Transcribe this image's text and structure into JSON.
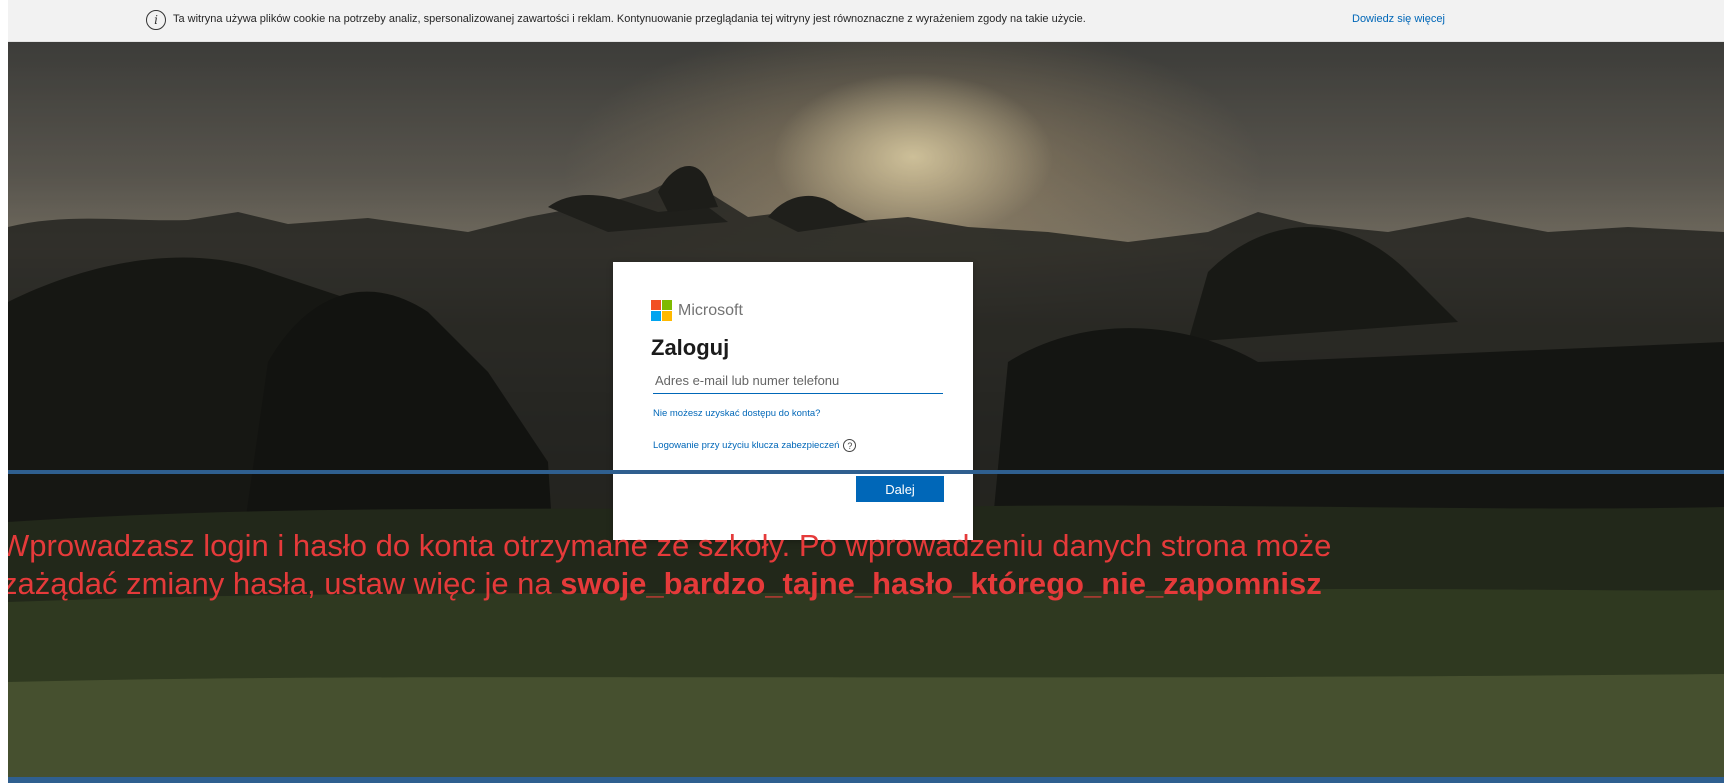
{
  "cookie_bar": {
    "text": "Ta witryna używa plików cookie na potrzeby analiz, spersonalizowanej zawartości i reklam. Kontynuowanie przeglądania tej witryny jest równoznaczne z wyrażeniem zgody na takie użycie.",
    "learn_more": "Dowiedz się więcej",
    "icon": "info-icon"
  },
  "signin": {
    "brand": "Microsoft",
    "title": "Zaloguj",
    "input_placeholder": "Adres e-mail lub numer telefonu",
    "input_value": "",
    "no_access_link": "Nie możesz uzyskać dostępu do konta?",
    "security_key_link": "Logowanie przy użyciu klucza zabezpieczeń",
    "help_icon": "question-circle-icon",
    "next_button": "Dalej"
  },
  "caption": {
    "line1": "Wprowadzasz login i hasło do konta otrzymane ze szkoły. Po wprowadzeniu danych strona może",
    "line2_prefix": "zażądać zmiany hasła, ustaw więc je na ",
    "line2_bold": "swoje_bardzo_tajne_hasło_którego_nie_zapomnisz"
  },
  "colors": {
    "accent": "#0067b8",
    "caption": "#e53a3a",
    "ms_red": "#f25022",
    "ms_green": "#7fba00",
    "ms_blue": "#00a4ef",
    "ms_yellow": "#ffb900",
    "rule": "#2f5f8f"
  }
}
